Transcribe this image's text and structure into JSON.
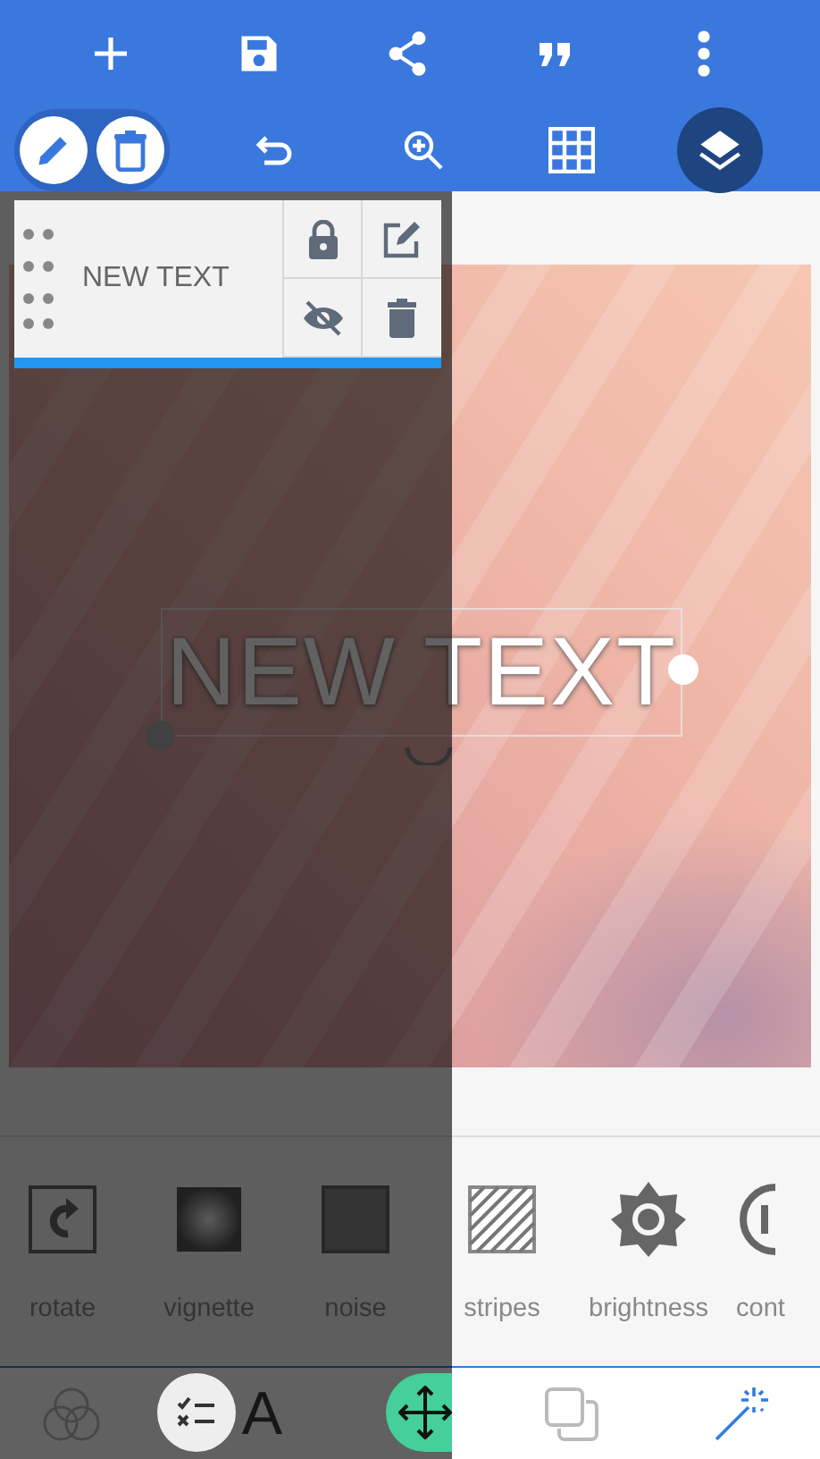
{
  "layer_panel": {
    "label": "NEW TEXT",
    "locked": true,
    "hidden": true
  },
  "canvas": {
    "text": "NEW TEXT"
  },
  "tools": [
    {
      "kind": "rotate",
      "label": "rotate"
    },
    {
      "kind": "vignette",
      "label": "vignette"
    },
    {
      "kind": "noise",
      "label": "noise"
    },
    {
      "kind": "stripes",
      "label": "stripes"
    },
    {
      "kind": "brightness",
      "label": "brightness"
    },
    {
      "kind": "contrast",
      "label": "cont"
    }
  ],
  "bottom_nav": [
    {
      "kind": "colors",
      "selected": false
    },
    {
      "kind": "text",
      "glyph": "A",
      "selected": false
    },
    {
      "kind": "layers",
      "selected": false
    },
    {
      "kind": "effects",
      "selected": true
    }
  ]
}
